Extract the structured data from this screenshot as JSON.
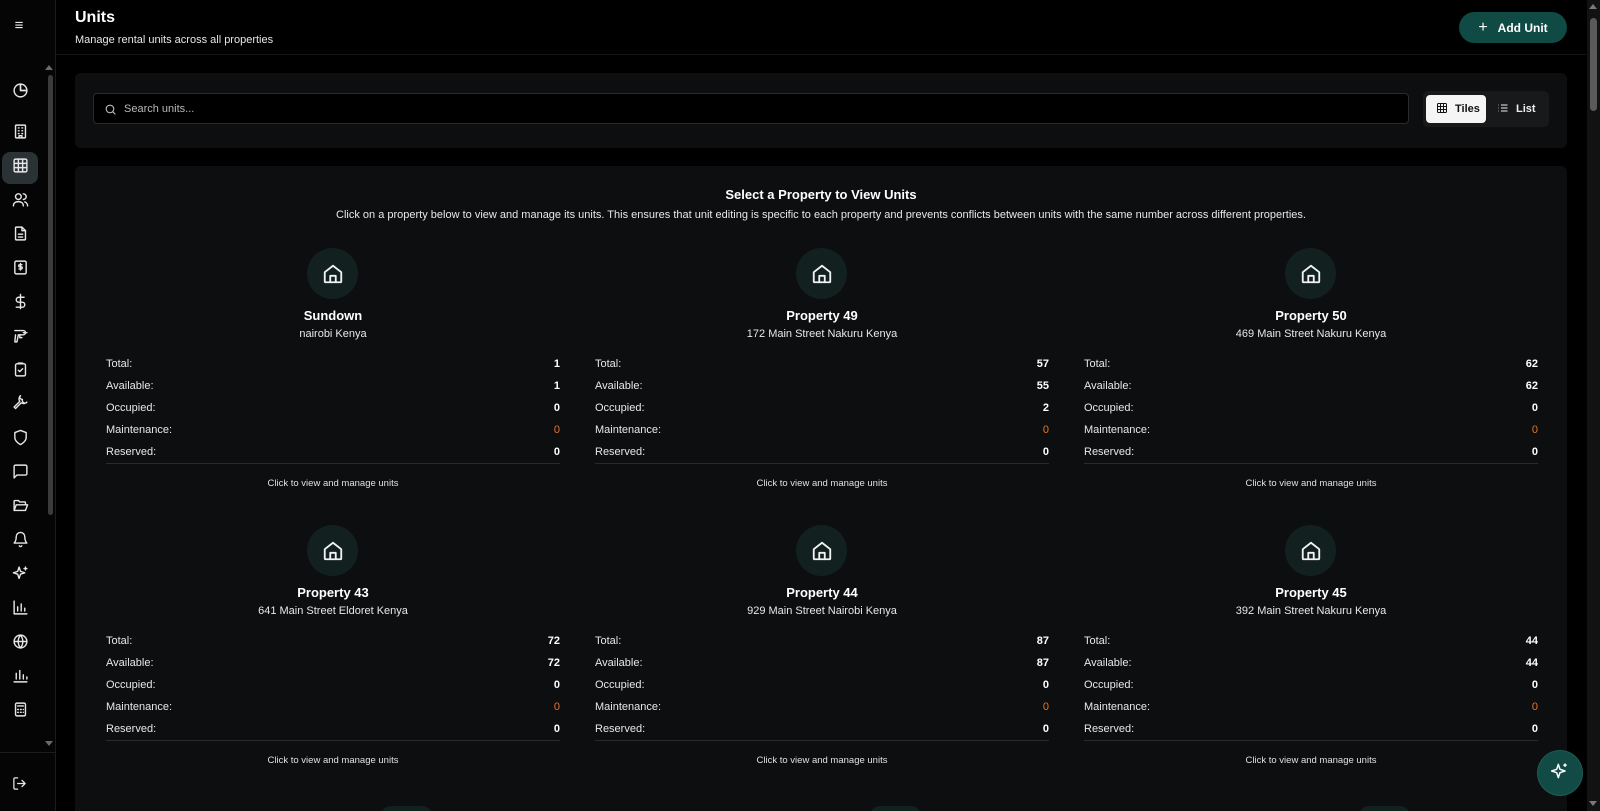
{
  "header": {
    "title": "Units",
    "subtitle": "Manage rental units across all properties",
    "add_button_label": "Add Unit"
  },
  "sidebar": {
    "items": [
      {
        "icon": "pie-chart-icon",
        "active": false
      },
      {
        "icon": "building-icon",
        "active": false
      },
      {
        "icon": "grid-icon",
        "active": true
      },
      {
        "icon": "users-icon",
        "active": false
      },
      {
        "icon": "file-text-icon",
        "active": false
      },
      {
        "icon": "receipt-icon",
        "active": false
      },
      {
        "icon": "dollar-icon",
        "active": false
      },
      {
        "icon": "drill-icon",
        "active": false
      },
      {
        "icon": "clipboard-check-icon",
        "active": false
      },
      {
        "icon": "wrench-icon",
        "active": false
      },
      {
        "icon": "shield-icon",
        "active": false
      },
      {
        "icon": "message-icon",
        "active": false
      },
      {
        "icon": "folder-open-icon",
        "active": false
      },
      {
        "icon": "bell-icon",
        "active": false
      },
      {
        "icon": "sparkles-icon",
        "active": false
      },
      {
        "icon": "bar-chart-icon",
        "active": false
      },
      {
        "icon": "brain-icon",
        "active": false
      },
      {
        "icon": "bar-chart-2-icon",
        "active": false
      },
      {
        "icon": "calculator-icon",
        "active": false
      }
    ],
    "logout_icon": "logout-icon"
  },
  "search": {
    "placeholder": "Search units..."
  },
  "view_toggle": {
    "tiles_label": "Tiles",
    "list_label": "List",
    "selected": "Tiles"
  },
  "section": {
    "title": "Select a Property to View Units",
    "description": "Click on a property below to view and manage its units. This ensures that unit editing is specific to each property and prevents conflicts between units with the same number across different properties."
  },
  "stat_labels": {
    "total": "Total:",
    "available": "Available:",
    "occupied": "Occupied:",
    "maintenance": "Maintenance:",
    "reserved": "Reserved:"
  },
  "card_cta": "Click to view and manage units",
  "colors": {
    "accent": "#0f4a44",
    "maintenance": "#e2762b",
    "panel": "#0d0e10"
  },
  "properties": [
    {
      "name": "Sundown",
      "address": "nairobi Kenya",
      "total": "1",
      "available": "1",
      "occupied": "0",
      "maintenance": "0",
      "reserved": "0"
    },
    {
      "name": "Property 49",
      "address": "172 Main Street Nakuru Kenya",
      "total": "57",
      "available": "55",
      "occupied": "2",
      "maintenance": "0",
      "reserved": "0"
    },
    {
      "name": "Property 50",
      "address": "469 Main Street Nakuru Kenya",
      "total": "62",
      "available": "62",
      "occupied": "0",
      "maintenance": "0",
      "reserved": "0"
    },
    {
      "name": "Property 43",
      "address": "641 Main Street Eldoret Kenya",
      "total": "72",
      "available": "72",
      "occupied": "0",
      "maintenance": "0",
      "reserved": "0"
    },
    {
      "name": "Property 44",
      "address": "929 Main Street Nairobi Kenya",
      "total": "87",
      "available": "87",
      "occupied": "0",
      "maintenance": "0",
      "reserved": "0"
    },
    {
      "name": "Property 45",
      "address": "392 Main Street Nakuru Kenya",
      "total": "44",
      "available": "44",
      "occupied": "0",
      "maintenance": "0",
      "reserved": "0"
    }
  ]
}
